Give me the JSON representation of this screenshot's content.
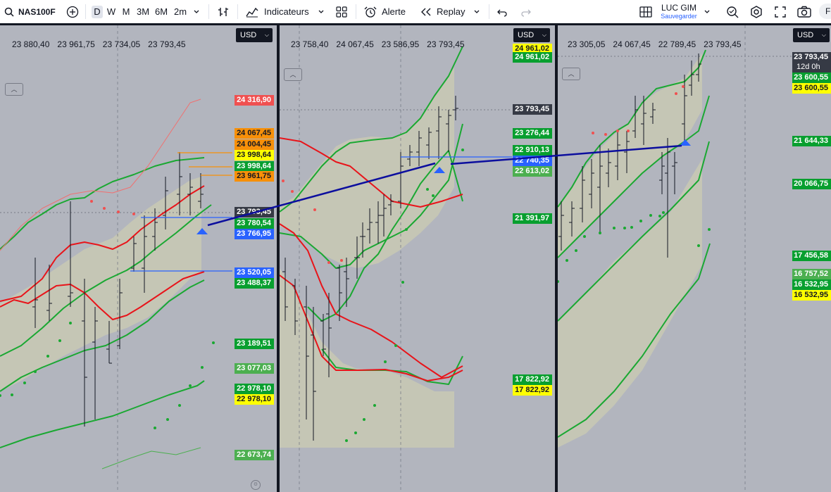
{
  "toolbar": {
    "symbol": "NAS100F",
    "timeframes": [
      "D",
      "W",
      "M",
      "3M",
      "6M",
      "2m"
    ],
    "active_timeframe": "D",
    "indicators_label": "Indicateurs",
    "alert_label": "Alerte",
    "replay_label": "Replay",
    "layout_name": "LUC GIM",
    "layout_status": "Sauvegarder",
    "avatar_letter": "F"
  },
  "panels": [
    {
      "currency": "USD",
      "ohlc": [
        "23 880,40",
        "23 961,75",
        "23 734,05",
        "23 793,45"
      ],
      "price_labels": [
        {
          "text": "24 316,90",
          "style": "red"
        },
        {
          "text": "24 067,45",
          "style": "orange"
        },
        {
          "text": "24 004,45",
          "style": "orange"
        },
        {
          "text": "23 998,64",
          "style": "yellow"
        },
        {
          "text": "23 998,64",
          "style": "green"
        },
        {
          "text": "23 961,75",
          "style": "orange"
        },
        {
          "text": "23 793,45",
          "style": "dark"
        },
        {
          "text": "23 780,54",
          "style": "green"
        },
        {
          "text": "23 766,95",
          "style": "blue"
        },
        {
          "text": "23 520,05",
          "style": "blue"
        },
        {
          "text": "23 488,37",
          "style": "green"
        },
        {
          "text": "23 189,51",
          "style": "green"
        },
        {
          "text": "23 077,03",
          "style": "lgreen"
        },
        {
          "text": "22 978,10",
          "style": "green"
        },
        {
          "text": "22 978,10",
          "style": "yellow"
        },
        {
          "text": "22 673,74",
          "style": "lgreen"
        }
      ]
    },
    {
      "currency": "USD",
      "ohlc": [
        "23 758,40",
        "24 067,45",
        "23 586,95",
        "23 793,45"
      ],
      "price_labels": [
        {
          "text": "24 961,02",
          "style": "yellow"
        },
        {
          "text": "24 961,02",
          "style": "green"
        },
        {
          "text": "23 793,45",
          "style": "dark"
        },
        {
          "text": "23 276,44",
          "style": "green"
        },
        {
          "text": "22 910,13",
          "style": "green"
        },
        {
          "text": "22 740,35",
          "style": "blue"
        },
        {
          "text": "22 613,02",
          "style": "lgreen"
        },
        {
          "text": "21 391,97",
          "style": "green"
        },
        {
          "text": "17 822,92",
          "style": "green"
        },
        {
          "text": "17 822,92",
          "style": "yellow"
        }
      ]
    },
    {
      "currency": "USD",
      "ohlc": [
        "23 305,05",
        "24 067,45",
        "22 789,45",
        "23 793,45"
      ],
      "countdown": "12d 0h",
      "price_labels": [
        {
          "text": "23 793,45",
          "style": "dark"
        },
        {
          "text": "23 600,55",
          "style": "green"
        },
        {
          "text": "23 600,55",
          "style": "yellow"
        },
        {
          "text": "21 644,33",
          "style": "green"
        },
        {
          "text": "20 066,75",
          "style": "green"
        },
        {
          "text": "17 456,58",
          "style": "green"
        },
        {
          "text": "16 757,52",
          "style": "lgreen"
        },
        {
          "text": "16 532,95",
          "style": "green"
        },
        {
          "text": "16 532,95",
          "style": "yellow"
        }
      ]
    }
  ],
  "colors": {
    "chart_bg": "#b2b5be",
    "band_fill": "#c8c9b4",
    "band_line": "#1aa832",
    "basis_line": "#e8141a",
    "outer_red": "#f07070",
    "bars": "#131722",
    "trendline": "#0c0e9e",
    "blue_level": "#2962ff",
    "orange_level": "#f79009"
  }
}
